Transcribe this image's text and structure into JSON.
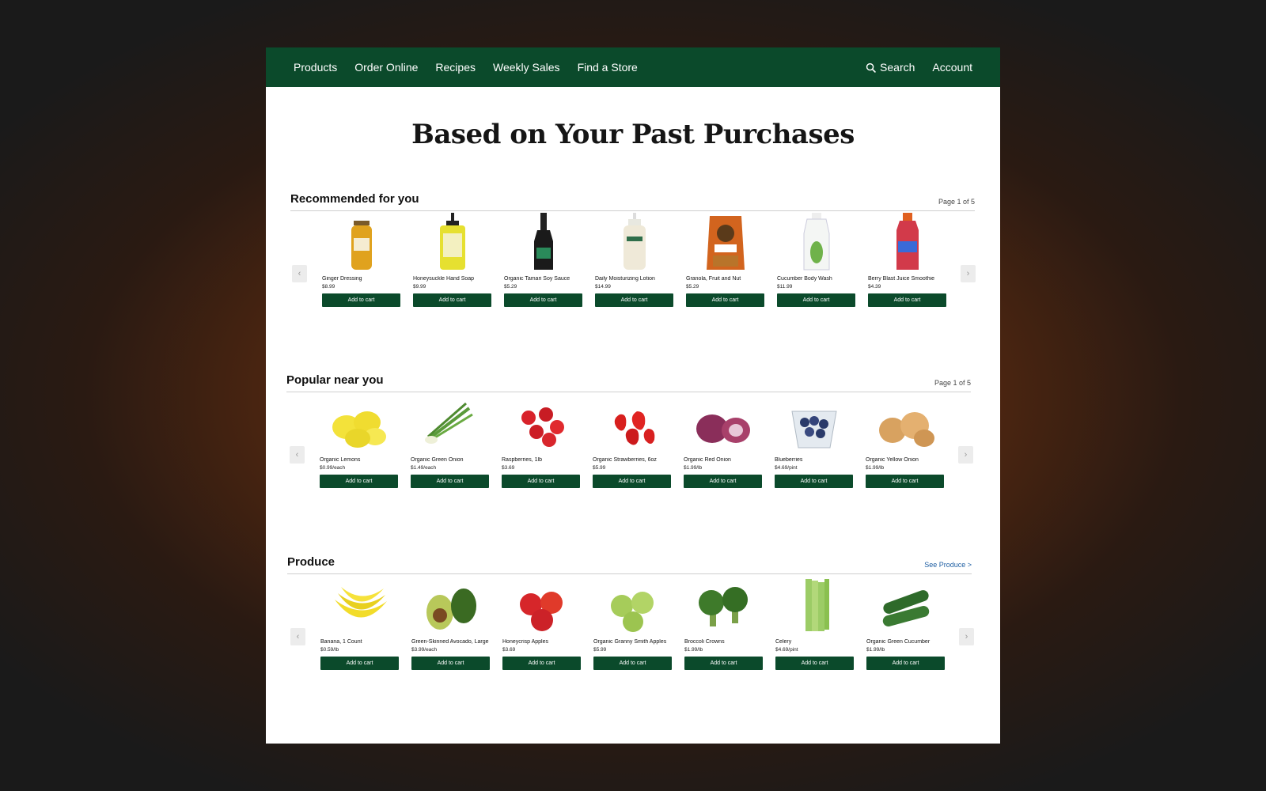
{
  "nav": {
    "items": [
      "Products",
      "Order Online",
      "Recipes",
      "Weekly Sales",
      "Find a Store"
    ],
    "search_label": "Search",
    "account_label": "Account"
  },
  "hero": {
    "title": "Based on Your Past Purchases"
  },
  "sections": [
    {
      "title": "Recommended for you",
      "meta": "Page 1 of 5",
      "products": [
        {
          "name": "Ginger Dressing",
          "price": "$8.99",
          "button": "Add to cart",
          "image": "ginger-dressing-bottle"
        },
        {
          "name": "Honeysuckle Hand Soap",
          "price": "$9.99",
          "button": "Add to cart",
          "image": "hand-soap-bottle"
        },
        {
          "name": "Organic Tamari Soy Sauce",
          "price": "$5.29",
          "button": "Add to cart",
          "image": "soy-sauce-bottle"
        },
        {
          "name": "Daily Moisturizing Lotion",
          "price": "$14.99",
          "button": "Add to cart",
          "image": "lotion-bottle"
        },
        {
          "name": "Granola, Fruit and Nut",
          "price": "$5.29",
          "button": "Add to cart",
          "image": "granola-bag"
        },
        {
          "name": "Cucumber Body Wash",
          "price": "$11.99",
          "button": "Add to cart",
          "image": "body-wash-bottle"
        },
        {
          "name": "Berry Blast Juice Smoothie",
          "price": "$4.39",
          "button": "Add to cart",
          "image": "smoothie-bottle"
        }
      ]
    },
    {
      "title": "Popular near you",
      "meta": "Page 1 of 5",
      "products": [
        {
          "name": "Organic Lemons",
          "price": "$0.99/each",
          "button": "Add to cart",
          "image": "lemons"
        },
        {
          "name": "Organic Green Onion",
          "price": "$1.49/each",
          "button": "Add to cart",
          "image": "green-onion"
        },
        {
          "name": "Raspberries, 1lb",
          "price": "$3.69",
          "button": "Add to cart",
          "image": "raspberries"
        },
        {
          "name": "Organic Strawberries, 6oz",
          "price": "$5.99",
          "button": "Add to cart",
          "image": "strawberries"
        },
        {
          "name": "Organic Red Onion",
          "price": "$1.99/lb",
          "button": "Add to cart",
          "image": "red-onion"
        },
        {
          "name": "Blueberries",
          "price": "$4.69/pint",
          "button": "Add to cart",
          "image": "blueberries"
        },
        {
          "name": "Organic Yellow Onion",
          "price": "$1.99/lb",
          "button": "Add to cart",
          "image": "yellow-onion"
        }
      ]
    },
    {
      "title": "Produce",
      "meta": "See Produce >",
      "products": [
        {
          "name": "Banana, 1 Count",
          "price": "$0.59/lb",
          "button": "Add to cart",
          "image": "bananas"
        },
        {
          "name": "Green-Skinned Avocado, Large",
          "price": "$3.99/each",
          "button": "Add to cart",
          "image": "avocado"
        },
        {
          "name": "Honeycrisp Apples",
          "price": "$3.69",
          "button": "Add to cart",
          "image": "red-apples"
        },
        {
          "name": "Organic Granny Smith Apples",
          "price": "$5.99",
          "button": "Add to cart",
          "image": "green-apples"
        },
        {
          "name": "Broccoli Crowns",
          "price": "$1.99/lb",
          "button": "Add to cart",
          "image": "broccoli"
        },
        {
          "name": "Celery",
          "price": "$4.69/pint",
          "button": "Add to cart",
          "image": "celery"
        },
        {
          "name": "Organic Green Cucumber",
          "price": "$1.99/lb",
          "button": "Add to cart",
          "image": "cucumbers"
        }
      ]
    }
  ],
  "colors": {
    "brand_green": "#0b4a2b",
    "link_blue": "#1f5fa3"
  },
  "icons": {
    "search": "search-icon",
    "prev": "chevron-left-icon",
    "next": "chevron-right-icon"
  }
}
